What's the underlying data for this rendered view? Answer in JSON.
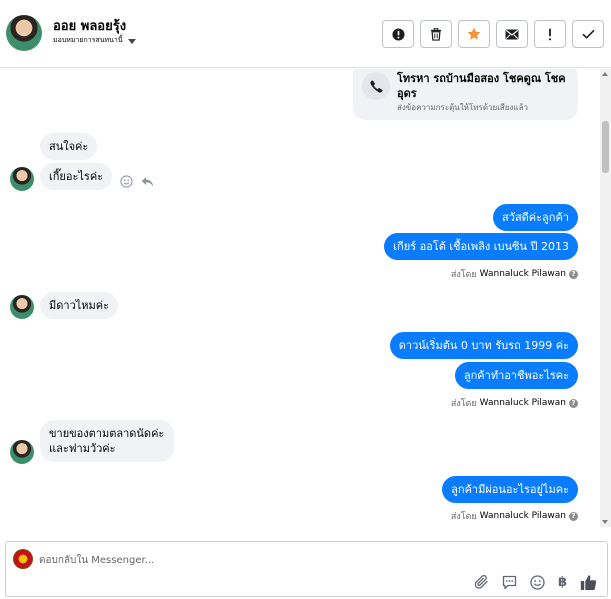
{
  "header": {
    "contact_name": "ออย พลอยรุ้ง",
    "assign_label": "มอบหมายการสนทนานี้",
    "actions": [
      {
        "name": "mark-spam",
        "icon": "alert-circle-icon"
      },
      {
        "name": "delete",
        "icon": "trash-icon"
      },
      {
        "name": "star",
        "icon": "star-icon"
      },
      {
        "name": "mark-unread",
        "icon": "envelope-icon"
      },
      {
        "name": "follow-up",
        "icon": "exclamation-icon"
      },
      {
        "name": "mark-done",
        "icon": "checkmark-icon"
      }
    ],
    "star_color": "#f7923a"
  },
  "thread": {
    "call_card": {
      "title": "โทรหา รถบ้านมือสอง โชคดูณ โชคอุดร",
      "subtitle": "ส่งข้อความกระตุ้นให้โทรด้วยเสียงแล้ว"
    },
    "messages": [
      {
        "dir": "in",
        "text": "สนใจค่ะ"
      },
      {
        "dir": "in",
        "text": "เกี๊ยอะไรค่ะ"
      },
      {
        "dir": "out",
        "text": "สวัสดีค่ะลูกค้า"
      },
      {
        "dir": "out",
        "text": "เกียร์ ออโต้  เชื้อเพลิง เบนซิน  ปี 2013"
      },
      {
        "dir": "in",
        "text": "มีดาวไหมค่ะ"
      },
      {
        "dir": "out",
        "text": "ดาวน์เริ่มต้น 0 บาท รับรถ 1999 ค่ะ"
      },
      {
        "dir": "out",
        "text": "ลูกค้าทำอาชีพอะไรคะ"
      },
      {
        "dir": "in",
        "text": "ขายของตามตลาดนัดค่ะ และฟามวัวค่ะ"
      },
      {
        "dir": "out",
        "text": "ลูกค้ามีผ่อนอะไรอยู่ไมคะ"
      }
    ],
    "sent_by": [
      {
        "prefix": "ส่งโดย",
        "name": "Wannaluck Pilawan"
      },
      {
        "prefix": "ส่งโดย",
        "name": "Wannaluck Pilawan"
      },
      {
        "prefix": "ส่งโดย",
        "name": "Wannaluck Pilawan"
      }
    ],
    "message_tools": [
      "smile-icon",
      "reply-arrow-icon"
    ],
    "bubble_out_color": "#0a7cff",
    "bubble_in_color": "#f0f2f5"
  },
  "composer": {
    "placeholder": "ตอบกลับใน Messenger...",
    "tools": [
      "paperclip-icon",
      "saved-reply-icon",
      "emoji-icon",
      "baht-icon",
      "thumbs-up-icon"
    ],
    "baht_symbol": "฿"
  }
}
